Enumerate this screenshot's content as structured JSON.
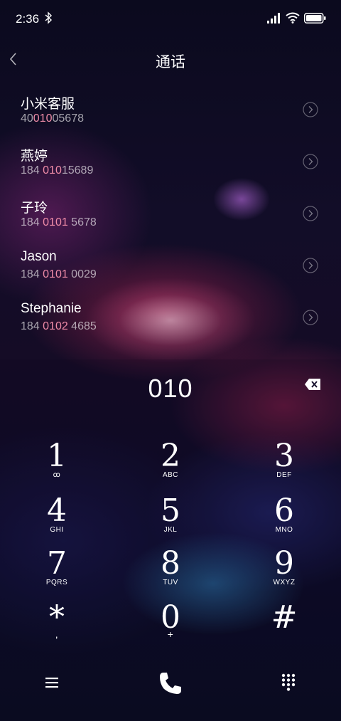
{
  "status": {
    "time": "2:36"
  },
  "header": {
    "title": "通话"
  },
  "contacts": [
    {
      "name": "小米客服",
      "number_pre": "40",
      "number_match": "010",
      "number_post": "05678"
    },
    {
      "name": "燕婷",
      "number_pre": "184 ",
      "number_match": "010",
      "number_post": "15689"
    },
    {
      "name": "子玲",
      "number_pre": "184 ",
      "number_match": "0101",
      "number_post": " 5678"
    },
    {
      "name": "Jason",
      "number_pre": "184 ",
      "number_match": "0101",
      "number_post": " 0029"
    },
    {
      "name": "Stephanie",
      "number_pre": "184 ",
      "number_match": "0102",
      "number_post": " 4685"
    }
  ],
  "dialer": {
    "dialed_number": "010",
    "keys": [
      {
        "digit": "1",
        "sub": "ꝏ"
      },
      {
        "digit": "2",
        "sub": "ABC"
      },
      {
        "digit": "3",
        "sub": "DEF"
      },
      {
        "digit": "4",
        "sub": "GHI"
      },
      {
        "digit": "5",
        "sub": "JKL"
      },
      {
        "digit": "6",
        "sub": "MNO"
      },
      {
        "digit": "7",
        "sub": "PQRS"
      },
      {
        "digit": "8",
        "sub": "TUV"
      },
      {
        "digit": "9",
        "sub": "WXYZ"
      },
      {
        "digit": "*",
        "sub": ","
      },
      {
        "digit": "0",
        "sub": "+"
      },
      {
        "digit": "#",
        "sub": ""
      }
    ]
  },
  "icons": {
    "back": "back-chevron-icon",
    "backspace": "backspace-icon",
    "menu": "menu-icon",
    "call": "phone-icon",
    "keypad": "dialpad-icon"
  },
  "colors": {
    "match_highlight": "#f08ca8"
  }
}
